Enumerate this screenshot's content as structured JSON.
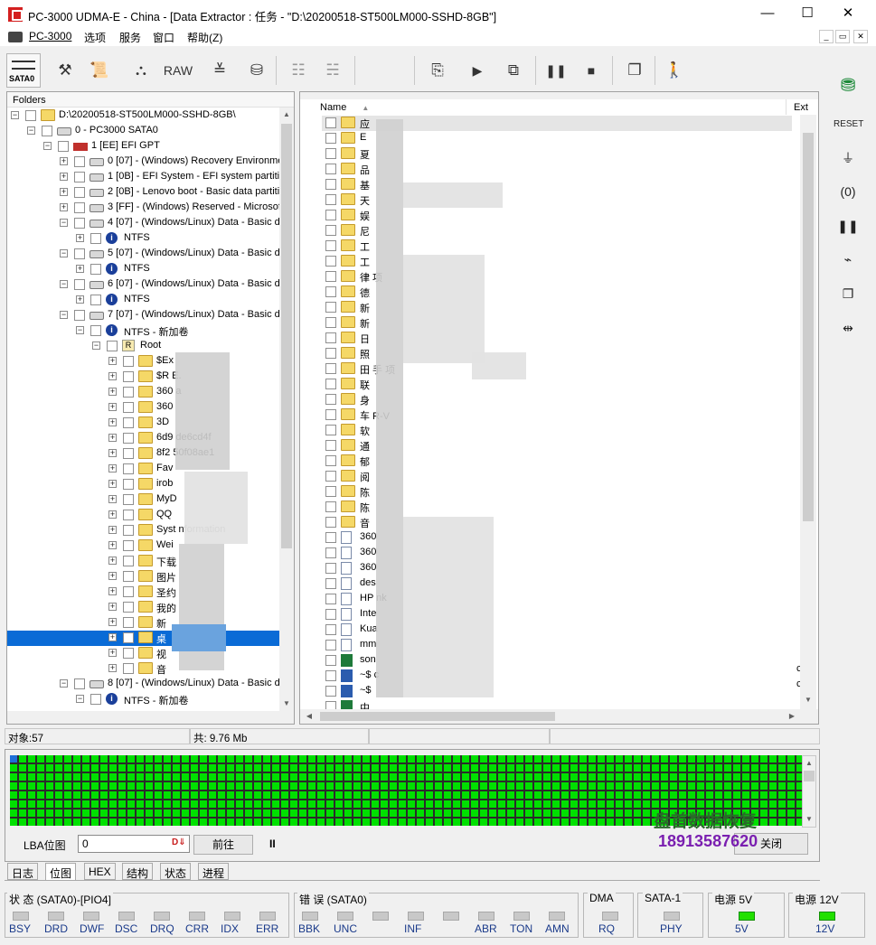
{
  "window": {
    "title": "PC-3000 UDMA-E - China - [Data Extractor : 任务 - \"D:\\20200518-ST500LM000-SSHD-8GB\"]",
    "minimize": "—",
    "maximize": "☐",
    "close": "✕"
  },
  "menu": {
    "items": [
      "PC-3000",
      "选项",
      "服务",
      "窗口",
      "帮助(Z)"
    ],
    "mdi": [
      "_",
      "▭",
      "✕"
    ]
  },
  "toolbar": {
    "sata_label": "SATA0",
    "raw_label": "RAW",
    "icons": [
      "drive-connect-icon",
      "tools-icon",
      "scroll-icon",
      "binoculars-icon",
      "raw-icon",
      "partition-icon",
      "disk-scan-icon",
      "tree-expand-icon",
      "tree-collapse-icon",
      "export-icon",
      "play-icon",
      "network-icon",
      "pause-icon",
      "stop-icon",
      "copy-windows-icon",
      "exit-icon"
    ]
  },
  "tree": {
    "header": "Folders",
    "rows": [
      {
        "text": "D:\\20200518-ST500LM000-SSHD-8GB\\",
        "icon": "folder-multi"
      },
      {
        "text": "0 - PC3000 SATA0",
        "icon": "disk"
      },
      {
        "text": "1 [EE] EFI GPT",
        "icon": "efi"
      },
      {
        "text": "0 [07] - (Windows) Recovery Environme",
        "icon": "disk"
      },
      {
        "text": "1 [0B] - EFI System - EFI system partitio",
        "icon": "disk"
      },
      {
        "text": "2 [0B] - Lenovo boot - Basic data partiti",
        "icon": "disk"
      },
      {
        "text": "3 [FF] - (Windows) Reserved - Microsof",
        "icon": "disk"
      },
      {
        "text": "4 [07] - (Windows/Linux) Data - Basic d",
        "icon": "disk"
      },
      {
        "text": "NTFS",
        "icon": "info"
      },
      {
        "text": "5 [07] - (Windows/Linux) Data - Basic d",
        "icon": "disk"
      },
      {
        "text": "NTFS",
        "icon": "info"
      },
      {
        "text": "6 [07] - (Windows/Linux) Data - Basic d",
        "icon": "disk"
      },
      {
        "text": "NTFS",
        "icon": "info"
      },
      {
        "text": "7 [07] - (Windows/Linux) Data - Basic d",
        "icon": "disk"
      },
      {
        "text": "NTFS - 新加卷",
        "icon": "info"
      },
      {
        "text": "Root",
        "icon": "root"
      },
      {
        "text": "$Ex",
        "icon": "folder"
      },
      {
        "text": "$R        E.",
        "icon": "folder"
      },
      {
        "text": "360       a",
        "icon": "folder"
      },
      {
        "text": "360",
        "icon": "folder"
      },
      {
        "text": "3D",
        "icon": "folder"
      },
      {
        "text": "6d9                    de6cd4f",
        "icon": "folder"
      },
      {
        "text": "8f2                    50f08ae1",
        "icon": "folder"
      },
      {
        "text": "Fav",
        "icon": "folder"
      },
      {
        "text": "irob",
        "icon": "folder"
      },
      {
        "text": "MyD",
        "icon": "folder"
      },
      {
        "text": "QQ",
        "icon": "folder"
      },
      {
        "text": "Syst                     nformation",
        "icon": "folder"
      },
      {
        "text": "Wei",
        "icon": "folder"
      },
      {
        "text": "下载",
        "icon": "folder"
      },
      {
        "text": "图片",
        "icon": "folder"
      },
      {
        "text": "圣约",
        "icon": "folder"
      },
      {
        "text": "我的",
        "icon": "folder"
      },
      {
        "text": "新",
        "icon": "folder"
      },
      {
        "text": "桌",
        "icon": "folder"
      },
      {
        "text": "视",
        "icon": "folder"
      },
      {
        "text": "音",
        "icon": "folder"
      },
      {
        "text": "8 [07] - (Windows/Linux) Data - Basic d",
        "icon": "disk"
      },
      {
        "text": "NTFS - 新加卷",
        "icon": "info"
      }
    ]
  },
  "list": {
    "col_name": "Name",
    "col_ext": "Ext",
    "rows": [
      {
        "text": "应",
        "icon": "folder"
      },
      {
        "text": "E",
        "icon": "folder"
      },
      {
        "text": "夏",
        "icon": "folder"
      },
      {
        "text": "品",
        "icon": "folder"
      },
      {
        "text": "基",
        "icon": "folder"
      },
      {
        "text": "天",
        "icon": "folder"
      },
      {
        "text": "娱",
        "icon": "folder"
      },
      {
        "text": "尼",
        "icon": "folder"
      },
      {
        "text": "工",
        "icon": "folder"
      },
      {
        "text": "工",
        "icon": "folder"
      },
      {
        "text": "律                         项",
        "icon": "folder"
      },
      {
        "text": "德",
        "icon": "folder"
      },
      {
        "text": "新",
        "icon": "folder"
      },
      {
        "text": "新",
        "icon": "folder"
      },
      {
        "text": "日",
        "icon": "folder"
      },
      {
        "text": "照",
        "icon": "folder"
      },
      {
        "text": "田            手             项",
        "icon": "folder"
      },
      {
        "text": "联",
        "icon": "folder"
      },
      {
        "text": "身",
        "icon": "folder"
      },
      {
        "text": "车           R-V",
        "icon": "folder"
      },
      {
        "text": "软",
        "icon": "folder"
      },
      {
        "text": "通",
        "icon": "folder"
      },
      {
        "text": "郁",
        "icon": "folder"
      },
      {
        "text": "阅",
        "icon": "folder"
      },
      {
        "text": "陈",
        "icon": "folder"
      },
      {
        "text": "陈",
        "icon": "folder"
      },
      {
        "text": "音",
        "icon": "folder"
      },
      {
        "text": "360",
        "icon": "file"
      },
      {
        "text": "360",
        "icon": "file"
      },
      {
        "text": "360",
        "icon": "file"
      },
      {
        "text": "des",
        "icon": "file"
      },
      {
        "text": "HP                            nk",
        "icon": "file"
      },
      {
        "text": "Inte",
        "icon": "file"
      },
      {
        "text": "Kua",
        "icon": "file"
      },
      {
        "text": "mm",
        "icon": "file"
      },
      {
        "text": "son",
        "icon": "xls"
      },
      {
        "text": "~$                          c",
        "icon": "doc"
      },
      {
        "text": "~$",
        "icon": "doc"
      },
      {
        "text": "中",
        "icon": "xls"
      }
    ],
    "ext_values": [
      "c",
      "c"
    ]
  },
  "status": {
    "objects": "对象:57",
    "total": "共: 9.76 Mb"
  },
  "map": {
    "lba_label": "LBA位图",
    "lba_value": "0",
    "goto_button": "前往",
    "pause_icon": "II",
    "close_button": "关闭",
    "watermark_title": "盘首数据恢复",
    "watermark_phone": "18913587620"
  },
  "tabs": [
    "日志",
    "位图",
    "HEX",
    "结构",
    "状态",
    "进程"
  ],
  "indicators": {
    "status_group": "状 态 (SATA0)-[PIO4]",
    "status_leds": [
      "BSY",
      "DRD",
      "DWF",
      "DSC",
      "DRQ",
      "CRR",
      "IDX",
      "ERR"
    ],
    "error_group": "错 误 (SATA0)",
    "error_leds": [
      "BBK",
      "UNC",
      "",
      "INF",
      "",
      "ABR",
      "TON",
      "AMN"
    ],
    "dma_group": "DMA",
    "dma_leds": [
      "RQ"
    ],
    "sata_group": "SATA-1",
    "sata_leds": [
      "PHY"
    ],
    "p5_group": "电源 5V",
    "p5_leds": [
      "5V"
    ],
    "p12_group": "电源 12V",
    "p12_leds": [
      "12V"
    ]
  },
  "colors": {
    "selection": "#0a6bd6",
    "map_ok": "#00e000",
    "watermark_title": "#2a6a2a",
    "watermark_phone": "#7a1fb0",
    "led_on": "#22e000"
  }
}
